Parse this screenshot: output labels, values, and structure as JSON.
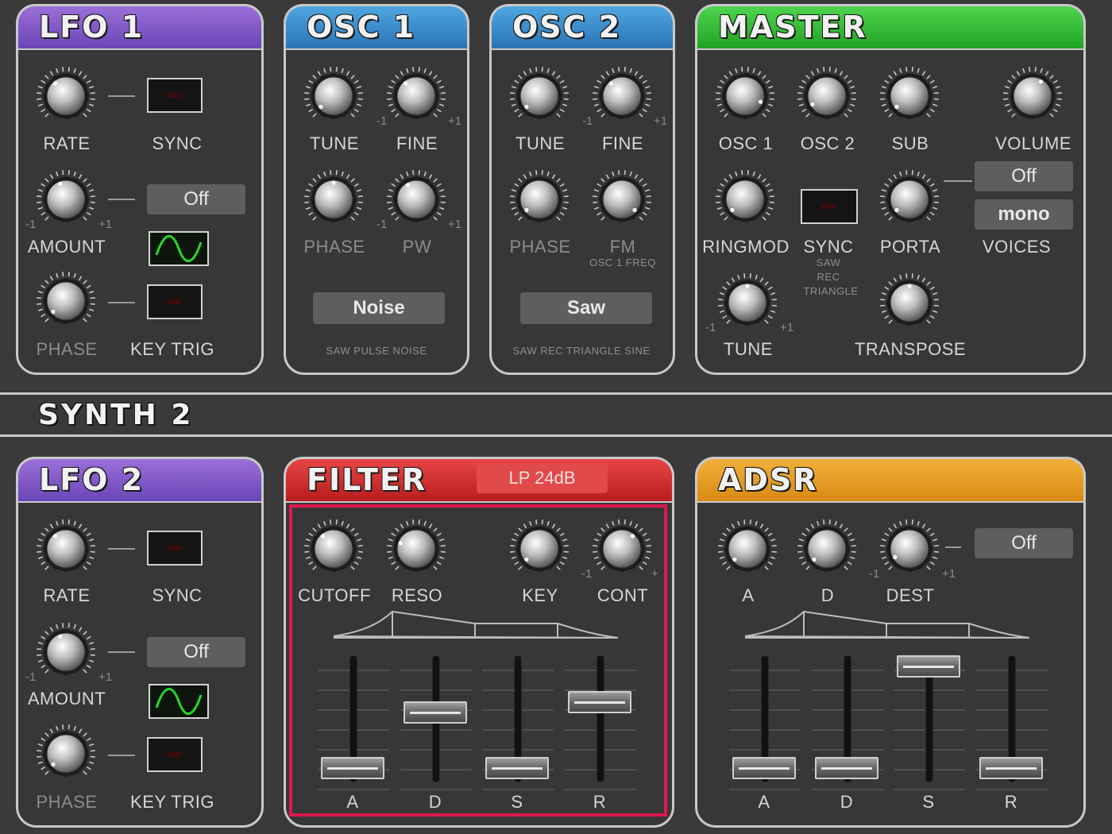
{
  "synth2_label": "SYNTH 2",
  "lfo1": {
    "title": "LFO 1",
    "rate": "RATE",
    "sync": "SYNC",
    "amount": "AMOUNT",
    "amount_min": "-1",
    "amount_max": "+1",
    "toggle": "Off",
    "phase": "PHASE",
    "key_trig": "KEY TRIG",
    "waveform": "sine-wave-icon"
  },
  "osc1": {
    "title": "OSC 1",
    "tune": "TUNE",
    "fine": "FINE",
    "fine_min": "-1",
    "fine_max": "+1",
    "phase": "PHASE",
    "pw": "PW",
    "pw_min": "-1",
    "pw_max": "+1",
    "wave_button": "Noise",
    "wave_options": "SAW  PULSE  NOISE"
  },
  "osc2": {
    "title": "OSC 2",
    "tune": "TUNE",
    "fine": "FINE",
    "fine_min": "-1",
    "fine_max": "+1",
    "phase": "PHASE",
    "fm": "FM",
    "fm_sub": "OSC 1 FREQ",
    "wave_button": "Saw",
    "wave_options": "SAW  REC  TRIANGLE  SINE"
  },
  "master": {
    "title": "MASTER",
    "osc1": "OSC 1",
    "osc2": "OSC 2",
    "sub": "SUB",
    "volume": "VOLUME",
    "ringmod": "RINGMOD",
    "sync": "SYNC",
    "sync_opt1": "SAW",
    "sync_opt2": "REC",
    "sync_opt3": "TRIANGLE",
    "porta": "PORTA",
    "porta_toggle": "Off",
    "voices_mode": "mono",
    "voices": "VOICES",
    "tune": "TUNE",
    "tune_min": "-1",
    "tune_max": "+1",
    "transpose": "TRANSPOSE"
  },
  "lfo2": {
    "title": "LFO 2",
    "rate": "RATE",
    "sync": "SYNC",
    "amount": "AMOUNT",
    "amount_min": "-1",
    "amount_max": "+1",
    "toggle": "Off",
    "phase": "PHASE",
    "key_trig": "KEY TRIG",
    "waveform": "sine-wave-icon"
  },
  "filter": {
    "title": "FILTER",
    "mode": "LP 24dB",
    "cutoff": "CUTOFF",
    "reso": "RESO",
    "key": "KEY",
    "cont": "CONT",
    "cont_min": "-1",
    "cont_max": "+",
    "a": "A",
    "d": "D",
    "s": "S",
    "r": "R",
    "faders": {
      "a": 0.0,
      "d": 0.55,
      "s": 0.0,
      "r": 0.65
    }
  },
  "adsr": {
    "title": "ADSR",
    "a_knob": "A",
    "d_knob": "D",
    "dest": "DEST",
    "dest_min": "-1",
    "dest_max": "+1",
    "toggle": "Off",
    "a": "A",
    "d": "D",
    "s": "S",
    "r": "R",
    "faders": {
      "a": 0.0,
      "d": 0.0,
      "s": 1.0,
      "r": 0.0
    }
  },
  "colors": {
    "lfo": "#7b52c8",
    "osc": "#3a8cd0",
    "master": "#33b833",
    "filter": "#d42a2a",
    "adsr": "#e89c22",
    "highlight": "#e0174f"
  }
}
